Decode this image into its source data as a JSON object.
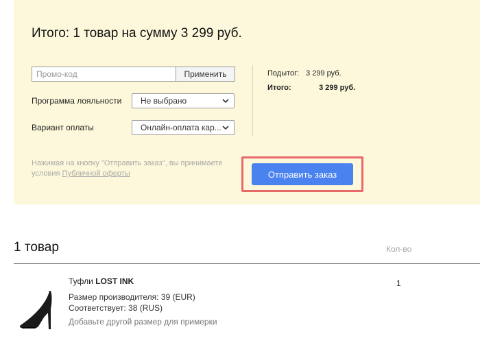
{
  "summary": {
    "title": "Итого: 1 товар на сумму 3 299 руб.",
    "promo": {
      "placeholder": "Промо-код",
      "value": "",
      "apply_label": "Применить"
    },
    "loyalty": {
      "label": "Программа лояльности",
      "selected": "Не выбрано"
    },
    "payment": {
      "label": "Вариант оплаты",
      "selected": "Онлайн-оплата кар..."
    },
    "subtotal": {
      "label": "Подытог:",
      "value": "3 299 руб."
    },
    "total": {
      "label": "Итого:",
      "value": "3 299 руб."
    },
    "legal": {
      "text": "Нажимая на кнопку \"Отправить заказ\", вы принимаете условия ",
      "link": "Публичной оферты"
    },
    "submit_label": "Отправить заказ"
  },
  "cart": {
    "heading": "1 товар",
    "qty_header": "Кол-во",
    "items": [
      {
        "type": "Туфли",
        "brand": "LOST INK",
        "size_manufacturer": "Размер производителя: 39 (EUR)",
        "size_match": "Соответствует: 38 (RUS)",
        "add_size_link": "Добавьте другой размер для примерки",
        "quantity": "1",
        "image_icon": "black-stiletto-shoe"
      }
    ]
  },
  "colors": {
    "panel_bg": "#fdf8db",
    "accent_button": "#4a82f0",
    "highlight_frame": "#e8696a"
  }
}
